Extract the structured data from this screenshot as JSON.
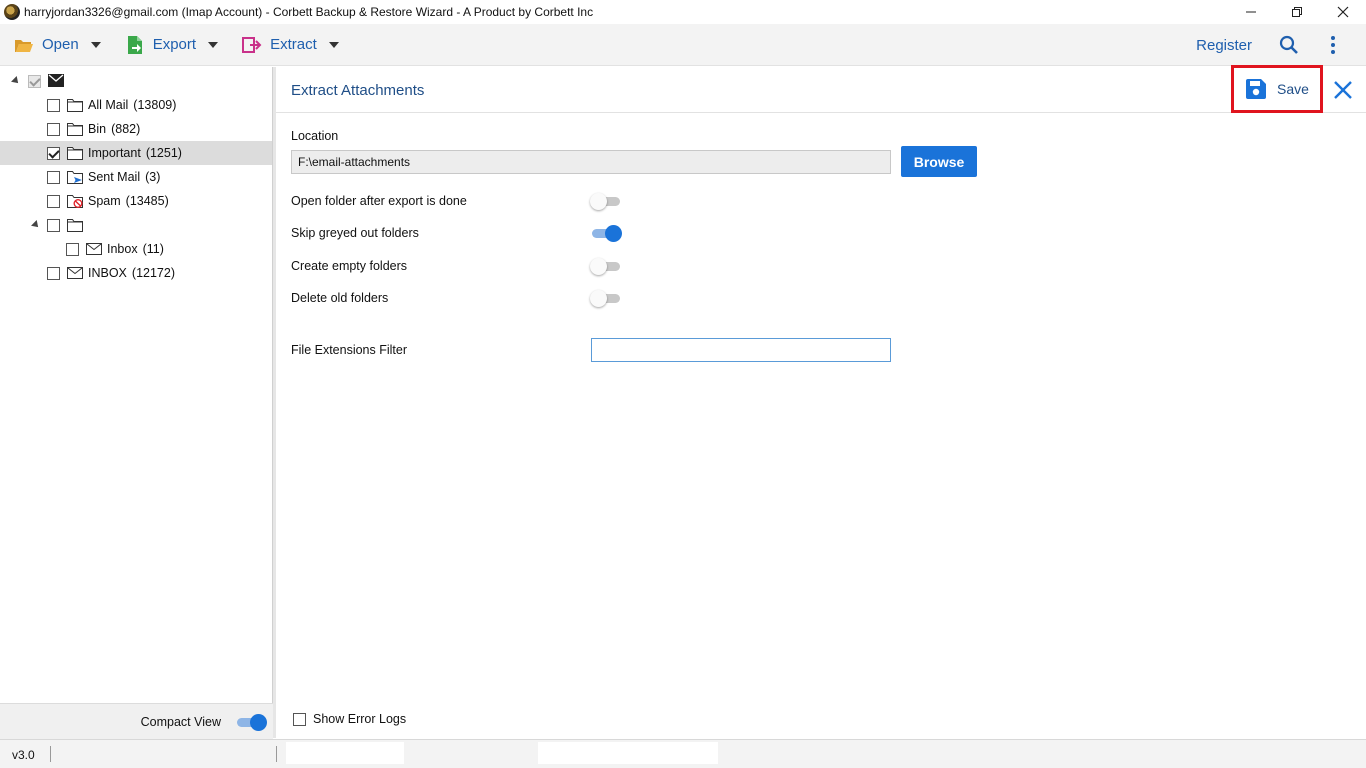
{
  "window": {
    "title": "harryjordan3326@gmail.com (Imap Account) - Corbett Backup & Restore Wizard - A Product by Corbett Inc",
    "controls": {
      "minimize": "—",
      "restore": "❐",
      "close": "✕"
    }
  },
  "toolbar": {
    "open_label": "Open",
    "export_label": "Export",
    "extract_label": "Extract",
    "register_label": "Register",
    "colors": {
      "link": "#1f5fae",
      "open_icon": "#e8a93a",
      "export_icon": "#3aa84a",
      "extract_icon": "#c9318a"
    }
  },
  "tree": {
    "items": [
      {
        "label": "All Mail",
        "count": "(13809)",
        "icon": "folder-icon"
      },
      {
        "label": "Bin",
        "count": "(882)",
        "icon": "folder-icon"
      },
      {
        "label": "Important",
        "count": "(1251)",
        "icon": "folder-icon",
        "checked": true,
        "selected": true
      },
      {
        "label": "Sent Mail",
        "count": "(3)",
        "icon": "sent-folder-icon"
      },
      {
        "label": "Spam",
        "count": "(13485)",
        "icon": "spam-folder-icon"
      },
      {
        "label": "Inbox",
        "count": "(11)",
        "icon": "envelope-icon"
      },
      {
        "label": "INBOX",
        "count": "(12172)",
        "icon": "envelope-icon"
      }
    ],
    "compact_view_label": "Compact View",
    "compact_view_on": true
  },
  "main": {
    "title": "Extract Attachments",
    "save_label": "Save",
    "location_label": "Location",
    "location_value": "F:\\email-attachments",
    "browse_label": "Browse",
    "options": [
      {
        "label": "Open folder after export is done",
        "on": false
      },
      {
        "label": "Skip greyed out folders",
        "on": true
      },
      {
        "label": "Create empty folders",
        "on": false
      },
      {
        "label": "Delete old folders",
        "on": false
      }
    ],
    "extension_filter_label": "File Extensions Filter",
    "extension_filter_value": "",
    "show_error_logs_label": "Show Error Logs",
    "accent_color": "#1a73d9",
    "highlight_color": "#e0141e"
  },
  "status": {
    "version": "v3.0"
  }
}
